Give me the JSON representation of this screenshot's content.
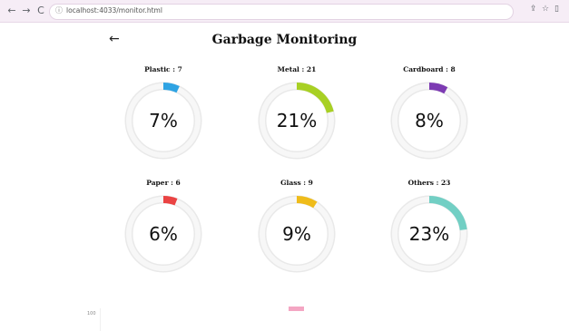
{
  "browser": {
    "url": "localhost:4033/monitor.html",
    "back_icon": "←",
    "forward_icon": "→",
    "reload_icon": "C"
  },
  "page": {
    "back_icon": "←",
    "title": "Garbage Monitoring"
  },
  "categories": [
    {
      "label": "Plastic : 7",
      "percent": "7%",
      "value": 7,
      "color": "#2ea3e3"
    },
    {
      "label": "Metal : 21",
      "percent": "21%",
      "value": 21,
      "color": "#a8d024"
    },
    {
      "label": "Cardboard : 8",
      "percent": "8%",
      "value": 8,
      "color": "#7d3bb3"
    },
    {
      "label": "Paper : 6",
      "percent": "6%",
      "value": 6,
      "color": "#ea4343"
    },
    {
      "label": "Glass : 9",
      "percent": "9%",
      "value": 9,
      "color": "#efbc1a"
    },
    {
      "label": "Others : 23",
      "percent": "23%",
      "value": 23,
      "color": "#72cfc4"
    }
  ],
  "footer": {
    "axis_label": "100"
  }
}
